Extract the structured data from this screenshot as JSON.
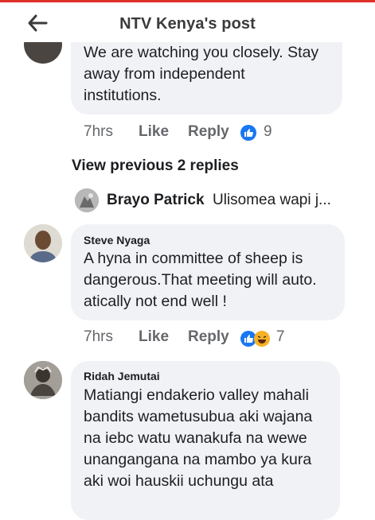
{
  "header": {
    "title": "NTV Kenya's post"
  },
  "comment1": {
    "lines": [
      "We are watching you closely. Stay",
      "away from independent",
      "institutions."
    ],
    "time": "7hrs",
    "like_label": "Like",
    "reply_label": "Reply",
    "reactions": [
      "like"
    ],
    "reaction_count": "9"
  },
  "view_previous": "View previous 2 replies",
  "reply_preview": {
    "name": "Brayo Patrick",
    "text": "Ulisomea wapi j..."
  },
  "comment2": {
    "name": "Steve Nyaga",
    "lines": [
      "A hyna in committee of sheep is",
      "dangerous.That meeting will auto.",
      "atically not end well !"
    ],
    "time": "7hrs",
    "like_label": "Like",
    "reply_label": "Reply",
    "reactions": [
      "like",
      "haha"
    ],
    "reaction_count": "7"
  },
  "comment3": {
    "name": "Ridah Jemutai",
    "lines": [
      "Matiangi endakerio valley mahali",
      "bandits wametusubua aki wajana",
      "na iebc watu wanakufa na wewe",
      "unangangana na mambo ya kura",
      "aki woi hauskii uchungu ata"
    ]
  },
  "colors": {
    "accent_red": "#e0302c",
    "like_blue": "#1877f2",
    "haha_yellow": "#f7b125",
    "bubble_gray": "#f0f2f5"
  }
}
